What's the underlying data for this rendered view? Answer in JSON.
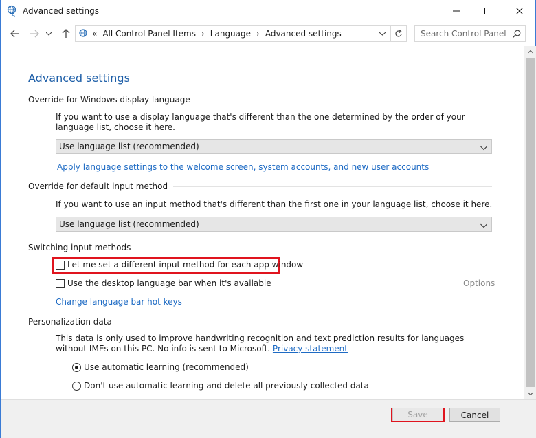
{
  "window": {
    "title": "Advanced settings",
    "minimize_label": "",
    "colors": {
      "accent": "#1e6bc4",
      "title": "#1e5fa8",
      "highlight": "#e0141e"
    }
  },
  "address_bar": {
    "overflow": "«",
    "crumbs": [
      "All Control Panel Items",
      "Language",
      "Advanced settings"
    ],
    "search_placeholder": "Search Control Panel"
  },
  "content": {
    "page_title": "Advanced settings",
    "display_language": {
      "heading": "Override for Windows display language",
      "description": "If you want to use a display language that's different than the one determined by the order of your language list, choose it here.",
      "selected": "Use language list (recommended)",
      "link": "Apply language settings to the welcome screen, system accounts, and new user accounts"
    },
    "input_method": {
      "heading": "Override for default input method",
      "description": "If you want to use an input method that's different than the first one in your language list, choose it here.",
      "selected": "Use language list (recommended)"
    },
    "switching": {
      "heading": "Switching input methods",
      "per_app_label": "Let me set a different input method for each app window",
      "per_app_checked": false,
      "language_bar_label": "Use the desktop language bar when it's available",
      "language_bar_checked": false,
      "options_label": "Options",
      "hotkeys_link": "Change language bar hot keys"
    },
    "personalization": {
      "heading": "Personalization data",
      "description_1": "This data is only used to improve handwriting recognition and text prediction results for languages without IMEs on this PC. No info is sent to Microsoft.",
      "privacy_link": "Privacy statement",
      "radio_auto": "Use automatic learning (recommended)",
      "radio_off": "Don't use automatic learning and delete all previously collected data",
      "selected": "auto"
    }
  },
  "footer": {
    "save_label": "Save",
    "cancel_label": "Cancel"
  }
}
